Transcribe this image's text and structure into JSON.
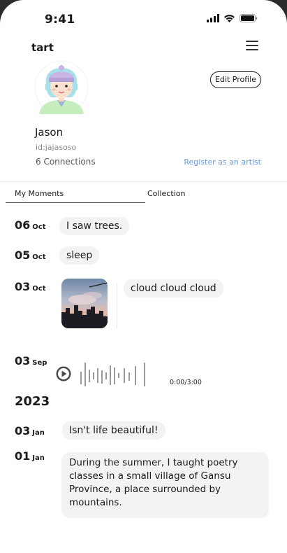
{
  "status": {
    "time": "9:41"
  },
  "header": {
    "brand": "tart"
  },
  "profile": {
    "edit_label": "Edit Profile",
    "name": "Jason",
    "id": "id:jajasoso",
    "connections": "6 Connections",
    "register": "Register as an artist"
  },
  "tabs": {
    "moments": "My Moments",
    "collection": "Collection"
  },
  "moments": [
    {
      "day": "06",
      "month": "Oct",
      "text": "I saw trees."
    },
    {
      "day": "05",
      "month": "Oct",
      "text": "sleep"
    },
    {
      "day": "03",
      "month": "Oct",
      "text": "cloud cloud cloud"
    },
    {
      "day": "03",
      "month": "Sep",
      "audio_time": "0:00/3:00"
    },
    {
      "day": "03",
      "month": "Jan",
      "text": "Isn't life beautiful!"
    },
    {
      "day": "01",
      "month": "Jan",
      "text": "During the summer, I taught poetry classes in a small village of Gansu Province, a place surrounded by mountains."
    }
  ],
  "year_label": "2023",
  "icons": {
    "signal": "signal-icon",
    "wifi": "wifi-icon",
    "battery": "battery-icon",
    "menu": "menu-icon",
    "play": "play-icon",
    "avatar": "avatar-illustration"
  },
  "colors": {
    "link": "#6a9bd8",
    "bubble": "#f3f3f3"
  }
}
